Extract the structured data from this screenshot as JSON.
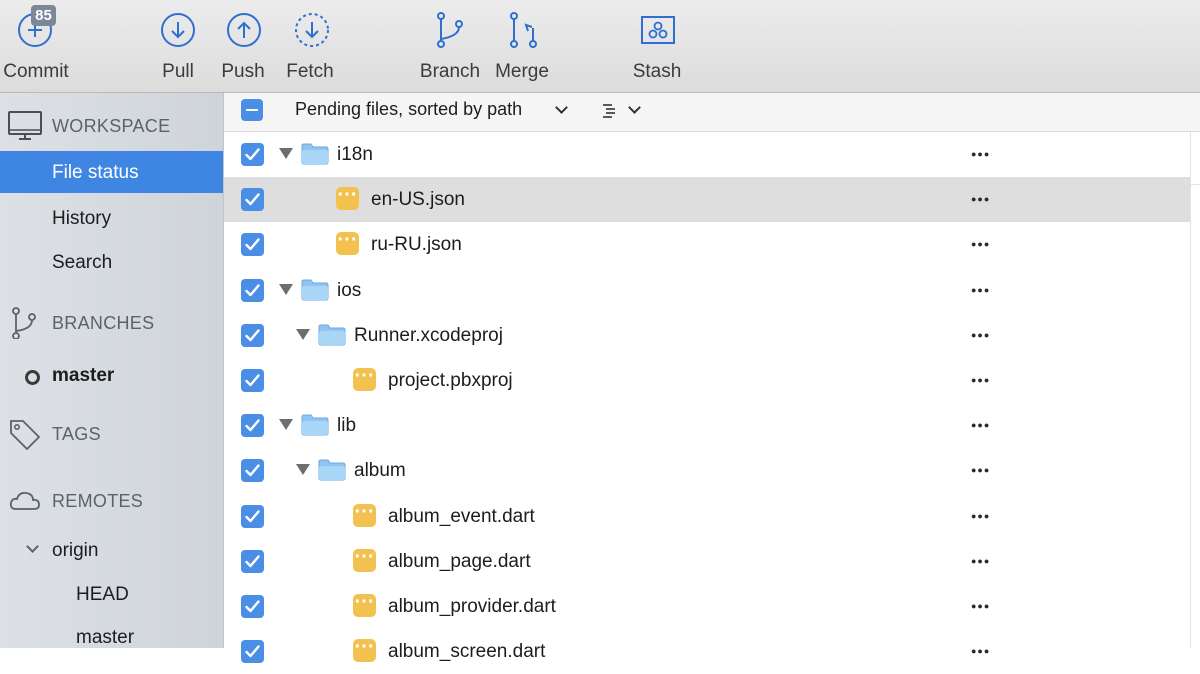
{
  "toolbar": {
    "commit_label": "Commit",
    "commit_badge": "85",
    "pull_label": "Pull",
    "push_label": "Push",
    "fetch_label": "Fetch",
    "branch_label": "Branch",
    "merge_label": "Merge",
    "stash_label": "Stash"
  },
  "sidebar": {
    "workspace": {
      "title": "WORKSPACE",
      "icon": "computer-icon"
    },
    "workspace_items": [
      "File status",
      "History",
      "Search"
    ],
    "selected_item": "File status",
    "branches": {
      "title": "BRANCHES",
      "icon": "branch-icon"
    },
    "branch_items": [
      "master"
    ],
    "tags": {
      "title": "TAGS",
      "icon": "tag-icon"
    },
    "remotes": {
      "title": "REMOTES",
      "icon": "cloud-icon"
    },
    "remote_items": [
      {
        "name": "origin",
        "children": [
          "HEAD",
          "master"
        ]
      }
    ]
  },
  "main": {
    "pending_title": "Pending files, sorted by path",
    "rows": [
      {
        "name": "i18n",
        "type": "folder",
        "depth": 0,
        "checked": true
      },
      {
        "name": "en-US.json",
        "type": "file",
        "depth": 1,
        "checked": true,
        "highlighted": true
      },
      {
        "name": "ru-RU.json",
        "type": "file",
        "depth": 1,
        "checked": true
      },
      {
        "name": "ios",
        "type": "folder",
        "depth": 0,
        "checked": true
      },
      {
        "name": "Runner.xcodeproj",
        "type": "folder",
        "depth": 1,
        "checked": true
      },
      {
        "name": "project.pbxproj",
        "type": "file",
        "depth": 2,
        "checked": true
      },
      {
        "name": "lib",
        "type": "folder",
        "depth": 0,
        "checked": true
      },
      {
        "name": "album",
        "type": "folder",
        "depth": 1,
        "checked": true
      },
      {
        "name": "album_event.dart",
        "type": "file",
        "depth": 2,
        "checked": true
      },
      {
        "name": "album_page.dart",
        "type": "file",
        "depth": 2,
        "checked": true
      },
      {
        "name": "album_provider.dart",
        "type": "file",
        "depth": 2,
        "checked": true
      },
      {
        "name": "album_screen.dart",
        "type": "file",
        "depth": 2,
        "checked": true
      }
    ],
    "more_icon": "ellipsis-icon"
  },
  "colors": {
    "accent": "#3f86e3",
    "checkbox": "#4a8ee6",
    "file_icon": "#f3c14f",
    "folder_icon": "#8ec5f2",
    "toolbar_icon": "#2f6fd1"
  }
}
